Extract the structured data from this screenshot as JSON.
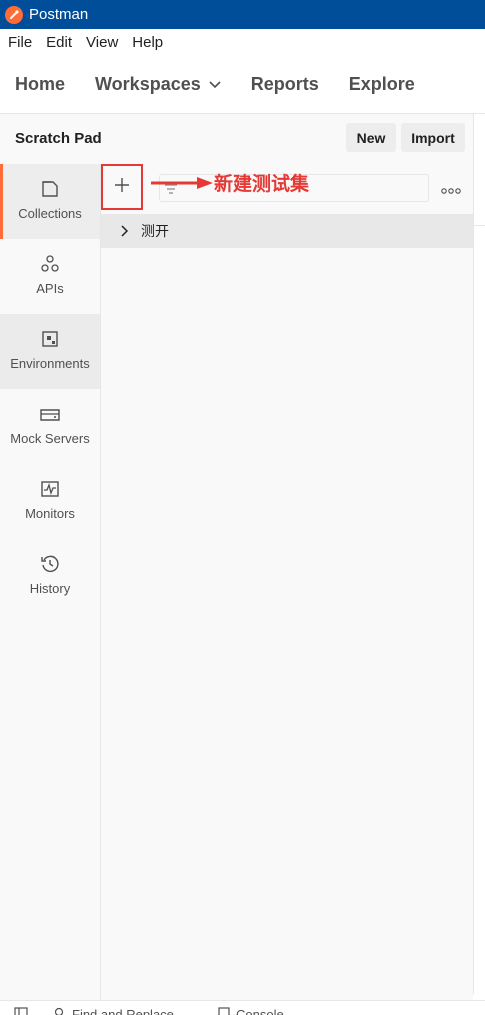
{
  "titlebar": {
    "title": "Postman",
    "logo_icon": "postman-logo-icon"
  },
  "menu": {
    "file": "File",
    "edit": "Edit",
    "view": "View",
    "help": "Help"
  },
  "nav": {
    "home": "Home",
    "workspaces": "Workspaces",
    "reports": "Reports",
    "explore": "Explore"
  },
  "workspace": {
    "title": "Scratch Pad",
    "new_label": "New",
    "import_label": "Import"
  },
  "sidebar": {
    "items": [
      {
        "label": "Collections",
        "icon": "collections-icon"
      },
      {
        "label": "APIs",
        "icon": "apis-icon"
      },
      {
        "label": "Environments",
        "icon": "environments-icon"
      },
      {
        "label": "Mock Servers",
        "icon": "mock-servers-icon"
      },
      {
        "label": "Monitors",
        "icon": "monitors-icon"
      },
      {
        "label": "History",
        "icon": "history-icon"
      }
    ]
  },
  "collections": {
    "annotation": "新建测试集",
    "filter_placeholder": "",
    "list": [
      {
        "name": "测开"
      }
    ]
  },
  "footer": {
    "find_replace": "Find and Replace",
    "console": "Console"
  },
  "colors": {
    "titlebar": "#004e9a",
    "accent": "#ff6c37",
    "annotation_red": "#e53935"
  }
}
